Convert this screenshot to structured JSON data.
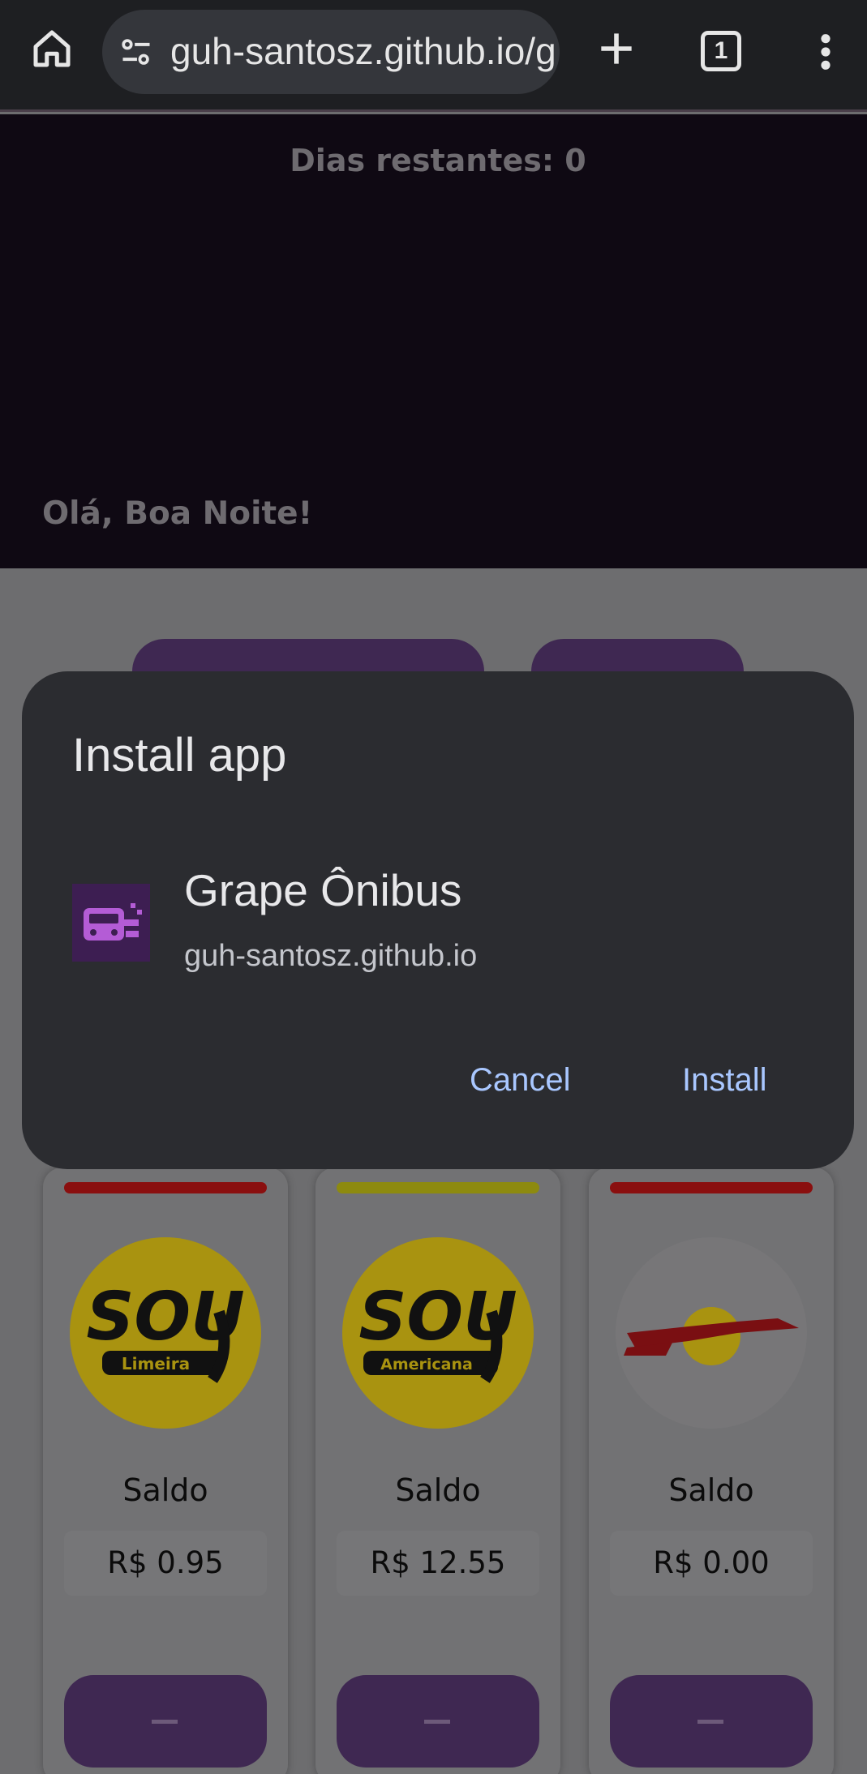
{
  "browser": {
    "url": "guh-santosz.github.io/g",
    "tab_count": "1",
    "icons": [
      "home-icon",
      "tune-icon",
      "plus-icon",
      "tab-switcher-icon",
      "more-vert-icon"
    ]
  },
  "page": {
    "days_remaining": "Dias restantes: 0",
    "greeting": "Olá, Boa Noite!",
    "cards": [
      {
        "logo_text": "SOU",
        "logo_sub": "Limeira",
        "status_color": "#8a0f0f",
        "saldo_label": "Saldo",
        "saldo_value": "R$ 0.95"
      },
      {
        "logo_text": "SOU",
        "logo_sub": "Americana",
        "status_color": "#8d8a0f",
        "saldo_label": "Saldo",
        "saldo_value": "R$ 12.55"
      },
      {
        "logo_text": "",
        "logo_sub": "",
        "status_color": "#8a0f0f",
        "saldo_label": "Saldo",
        "saldo_value": "R$ 0.00"
      }
    ]
  },
  "dialog": {
    "title": "Install app",
    "app_name": "Grape Ônibus",
    "app_host": "guh-santosz.github.io",
    "cancel_label": "Cancel",
    "install_label": "Install",
    "accent_color": "#a9c7ff"
  }
}
